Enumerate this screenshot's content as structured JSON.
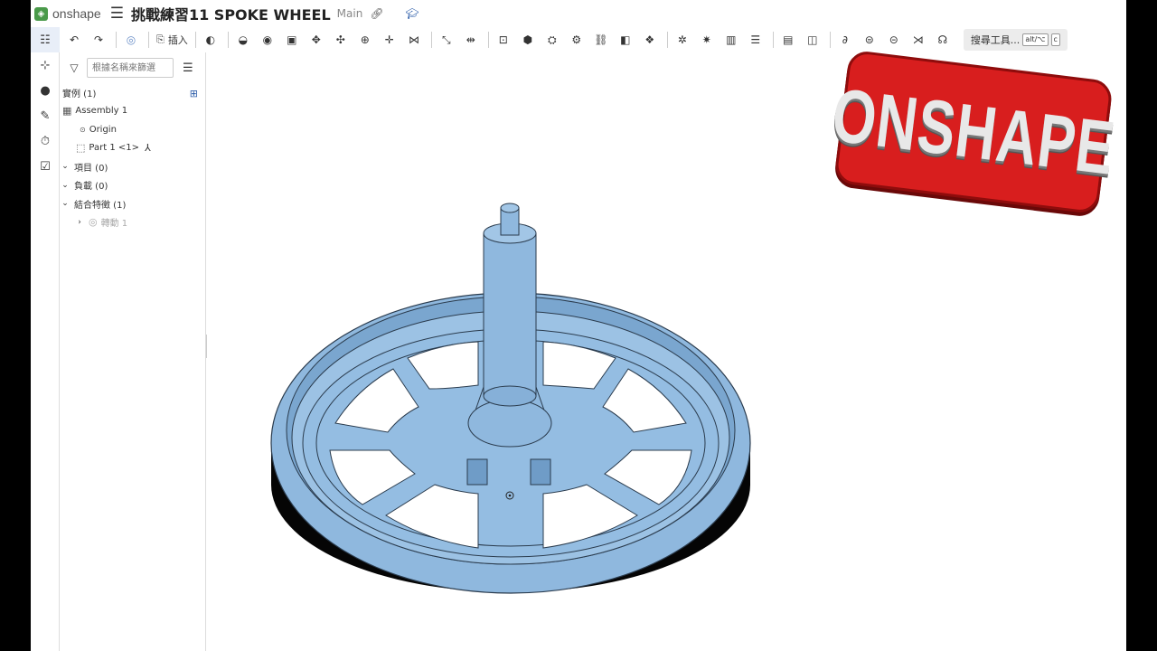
{
  "header": {
    "logo_text": "onshape",
    "doc_title": "挑戰練習11 SPOKE WHEEL",
    "branch": "Main"
  },
  "toolbar": {
    "insert_label": "插入",
    "search_label": "搜尋工具...",
    "shortcut_key1": "alt/⌥",
    "shortcut_key2": "c"
  },
  "panel": {
    "filter_placeholder": "根據名稱來篩選",
    "instances_label": "實例 (1)",
    "assembly_label": "Assembly 1",
    "origin_label": "Origin",
    "part_label": "Part 1 <1>",
    "items_label": "項目 (0)",
    "loads_label": "負載 (0)",
    "mates_label": "結合特徵 (1)",
    "revolute_label": "轉動 1"
  },
  "badge": {
    "text": "ONSHAPE"
  },
  "colors": {
    "part_fill": "#8fb8de",
    "part_stroke": "#2a3b4d",
    "badge_red": "#d81e1e"
  }
}
